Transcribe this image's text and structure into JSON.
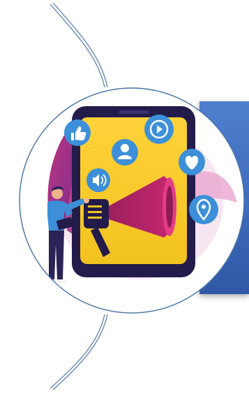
{
  "slide": {
    "accent_color": "#3f6bbb",
    "circle_border_color": "#4e78a8",
    "connector_color": "#4e78a8"
  },
  "illustration": {
    "subject": "marketing-megaphone-phone",
    "icons": [
      "thumbs-up-icon",
      "user-icon",
      "play-icon",
      "heart-icon",
      "location-pin-icon",
      "speaker-icon"
    ]
  }
}
